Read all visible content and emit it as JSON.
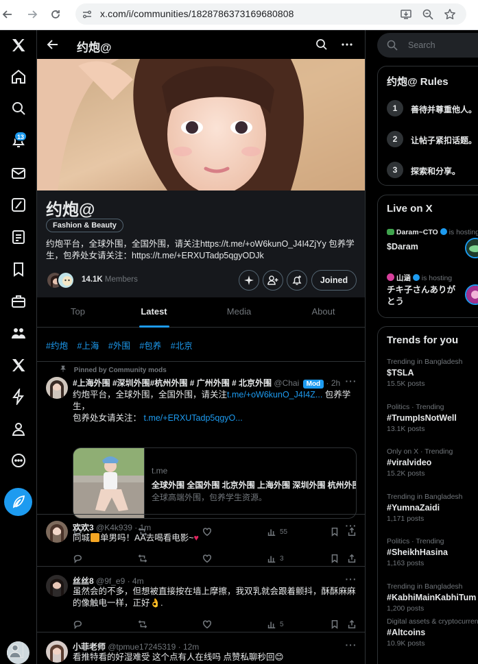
{
  "browser": {
    "url": "x.com/i/communities/1828786373169680808"
  },
  "rail": {
    "notifications_badge": "13"
  },
  "header": {
    "title": "约炮@"
  },
  "community": {
    "name": "约炮@",
    "category": "Fashion & Beauty",
    "description": "约炮平台，全球外围，全国外围，请关注https://t.me/+oW6kunO_J4I4ZjYy 包养学生，包养处女请关注：https://t.me/+ERXUTadp5qgyODJk",
    "member_count": "14.1K",
    "members_label": "Members",
    "joined_label": "Joined"
  },
  "tabs": [
    {
      "label": "Top"
    },
    {
      "label": "Latest"
    },
    {
      "label": "Media"
    },
    {
      "label": "About"
    }
  ],
  "hashtags": [
    "#约炮",
    "#上海",
    "#外围",
    "#包养",
    "#北京"
  ],
  "pinned": {
    "pinned_label": "Pinned by Community mods",
    "name": "#上海外围 #深圳外围#杭州外围 # 广州外围 # 北京外围",
    "handle": "@Chai",
    "mod_badge": "Mod",
    "time": "· 2h",
    "text_a": "约炮平台，全球外围，全国外围，请关注",
    "link_a": "t.me/+oW6kunO_J4I4Z...",
    "text_b": " 包养学生，",
    "text_c": "包养处女请关注：",
    "link_b": "t.me/+ERXUTadp5qgyO...",
    "card": {
      "domain": "t.me",
      "title": "全球外围 全国外围 北京外围 上海外围 深圳外围 杭州外围",
      "desc": "全球高端外围，包养学生资源。"
    },
    "views": "55"
  },
  "posts": [
    {
      "name": "欢欢3",
      "handle": "@K4k939 · 1m",
      "text_a": "同城",
      "text_b": "单男吗！AA去喝看电影~",
      "heart": "♥",
      "replies": "",
      "reposts": "",
      "likes": "",
      "views": "3"
    },
    {
      "name": "丝丝8",
      "handle": "@9f_e9 · 4m",
      "text": "虽然会的不多，但想被直接按在墙上摩擦，我双乳就会跟着颤抖，酥酥麻麻的像触电一样，正好👌.",
      "views": "5"
    },
    {
      "name": "小菲老师",
      "handle": "@tpmue17245319 · 12m",
      "text": "看推特看的好湿难受 这个点有人在线吗 点赞私聊秒回😊"
    }
  ],
  "search": {
    "placeholder": "Search"
  },
  "rules": {
    "title": "约炮@ Rules",
    "items": [
      {
        "num": "1",
        "text": "善待并尊重他人。"
      },
      {
        "num": "2",
        "text": "让帖子紧扣话题。"
      },
      {
        "num": "3",
        "text": "探索和分享。"
      }
    ]
  },
  "live": {
    "title": "Live on X",
    "items": [
      {
        "host": "Daram~CTO",
        "status": "is hosting",
        "title": "$Daram"
      },
      {
        "host": "山涵",
        "status": "is hosting",
        "title": "チキ子さんありがとう"
      }
    ]
  },
  "trends": {
    "title": "Trends for you",
    "items": [
      {
        "context": "Trending in Bangladesh",
        "name": "$TSLA",
        "posts": "15.5K posts"
      },
      {
        "context": "Politics · Trending",
        "name": "#TrumpIsNotWell",
        "posts": "13.1K posts"
      },
      {
        "context": "Only on X · Trending",
        "name": "#viralvideo",
        "posts": "15.2K posts"
      },
      {
        "context": "Trending in Bangladesh",
        "name": "#YumnaZaidi",
        "posts": "1,171 posts"
      },
      {
        "context": "Politics · Trending",
        "name": "#SheikhHasina",
        "posts": "1,163 posts"
      },
      {
        "context": "Trending in Bangladesh",
        "name": "#KabhiMainKabhiTum",
        "posts": "1,200 posts"
      },
      {
        "context": "Digital assets & cryptocurrency",
        "name": "#Altcoins",
        "posts": "10.9K posts"
      }
    ]
  }
}
